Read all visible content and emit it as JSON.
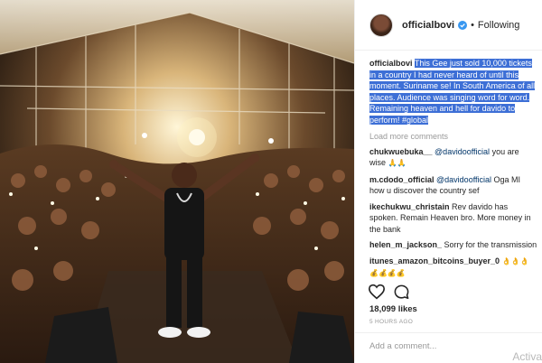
{
  "post": {
    "username": "officialbovi",
    "follow_status": "Following",
    "separator": "•",
    "caption": {
      "username": "officialbovi",
      "text": "This Gee just sold 10,000 tickets in a country I had never heard of until this moment. Suriname se! In South America of all places. Audience was singing word for word. Remaining heaven and hell for davido to perform! #global"
    },
    "load_more": "Load more comments",
    "comments": [
      {
        "user": "chukwuebuka__",
        "mention": "@davidoofficial",
        "text": " you are wise",
        "emoji": "🙏🙏"
      },
      {
        "user": "m.cdodo_official",
        "mention": "@davidoofficial",
        "text": " Oga MI how u discover the country sef",
        "emoji": ""
      },
      {
        "user": "ikechukwu_christain",
        "mention": "",
        "text": " Rev davido has spoken. Remain Heaven bro. More money in the bank",
        "emoji": ""
      },
      {
        "user": "helen_m_jackson_",
        "mention": "",
        "text": " Sorry for the transmission",
        "emoji": ""
      },
      {
        "user": "itunes_amazon_bitcoins_buyer_0",
        "mention": "",
        "text": " ",
        "emoji": "👌👌👌💰💰💰💰"
      }
    ],
    "likes": "18,099 likes",
    "time": "5 HOURS AGO",
    "add_comment_placeholder": "Add a comment..."
  },
  "watermark": "Activa",
  "icons": {
    "verified": "verified-badge-icon",
    "like": "heart-icon",
    "comment": "comment-bubble-icon"
  },
  "colors": {
    "highlight": "#3d6fd6",
    "mention": "#003569",
    "verified": "#3897f0"
  }
}
